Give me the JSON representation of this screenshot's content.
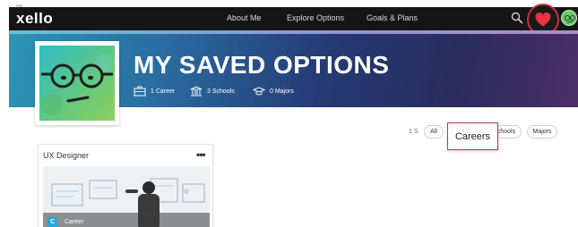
{
  "nav": {
    "logo": "xello",
    "links": [
      "About Me",
      "Explore Options",
      "Goals & Plans"
    ],
    "icons": [
      "search-icon",
      "heart-icon",
      "avatar"
    ]
  },
  "banner": {
    "title": "MY SAVED OPTIONS",
    "stats": [
      {
        "label": "1 Career",
        "icon": "briefcase-icon"
      },
      {
        "label": "3 Schools",
        "icon": "school-icon"
      },
      {
        "label": "0 Majors",
        "icon": "graduation-cap-icon"
      }
    ]
  },
  "filters": {
    "result_count": "1 S",
    "options": [
      "All",
      "Careers",
      "Schools",
      "Majors"
    ],
    "visible_labels": {
      "all": "All",
      "careers": "Careers",
      "schools": "chools",
      "majors": "Majors"
    }
  },
  "cards": [
    {
      "title": "UX Designer",
      "menu": "•••",
      "type_badge": "C",
      "type": "Career"
    }
  ],
  "colors": {
    "nav_bg": "#151515",
    "heart": "#e8323e",
    "highlight_border": "#c9343e",
    "career_badge": "#29a7d6"
  }
}
